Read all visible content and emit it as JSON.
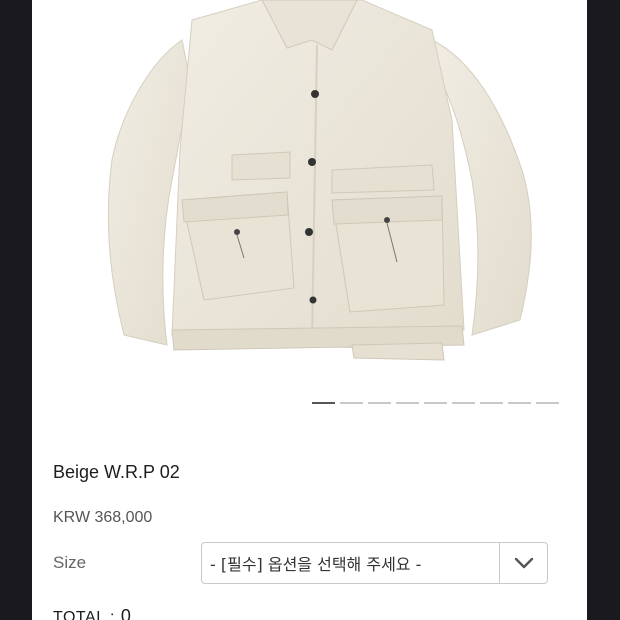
{
  "product": {
    "image_alt": "beige jacket",
    "title": "Beige W.R.P 02",
    "price": "KRW 368,000"
  },
  "carousel": {
    "count": 9,
    "active_index": 0
  },
  "options": {
    "size_label": "Size",
    "size_select_value": "- [필수] 옵션을 선택해 주세요 -"
  },
  "total": {
    "label": "TOTAL :",
    "value": "0"
  },
  "colors": {
    "background": "#1a1a1e",
    "jacket": "#ece7da"
  }
}
